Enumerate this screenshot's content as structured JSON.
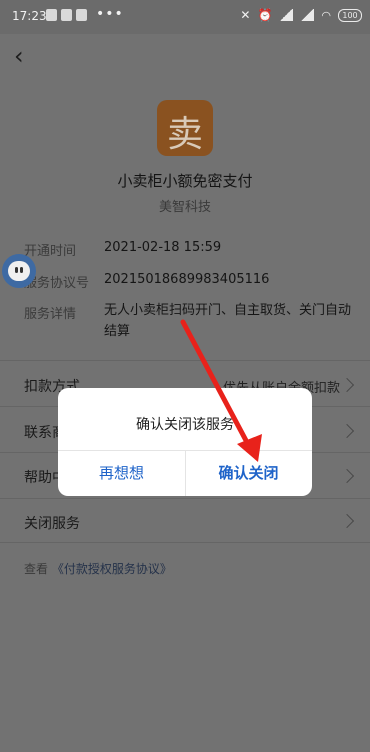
{
  "status_bar": {
    "time": "17:23",
    "dots": "•••",
    "battery": "100"
  },
  "nav": {
    "back_icon": "chevron-left-icon"
  },
  "app": {
    "logo_glyph": "卖",
    "name": "小卖柜小额免密支付",
    "company": "美智科技"
  },
  "info": [
    {
      "label": "开通时间",
      "value": "2021-02-18 15:59"
    },
    {
      "label": "服务协议号",
      "value": "20215018689983405116"
    },
    {
      "label": "服务详情",
      "value": "无人小卖柜扫码开门、自主取货、关门自动结算"
    }
  ],
  "rows": [
    {
      "label": "扣款方式",
      "value": "优先从账户余额扣款"
    },
    {
      "label": "联系商家",
      "value": ""
    },
    {
      "label": "帮助中心",
      "value": ""
    },
    {
      "label": "关闭服务",
      "value": ""
    }
  ],
  "agreement": {
    "prefix": "查看",
    "link": "《付款授权服务协议》"
  },
  "dialog": {
    "title": "确认关闭该服务",
    "cancel": "再想想",
    "confirm": "确认关闭"
  },
  "annotation": {
    "arrow_color": "#e8221b"
  }
}
